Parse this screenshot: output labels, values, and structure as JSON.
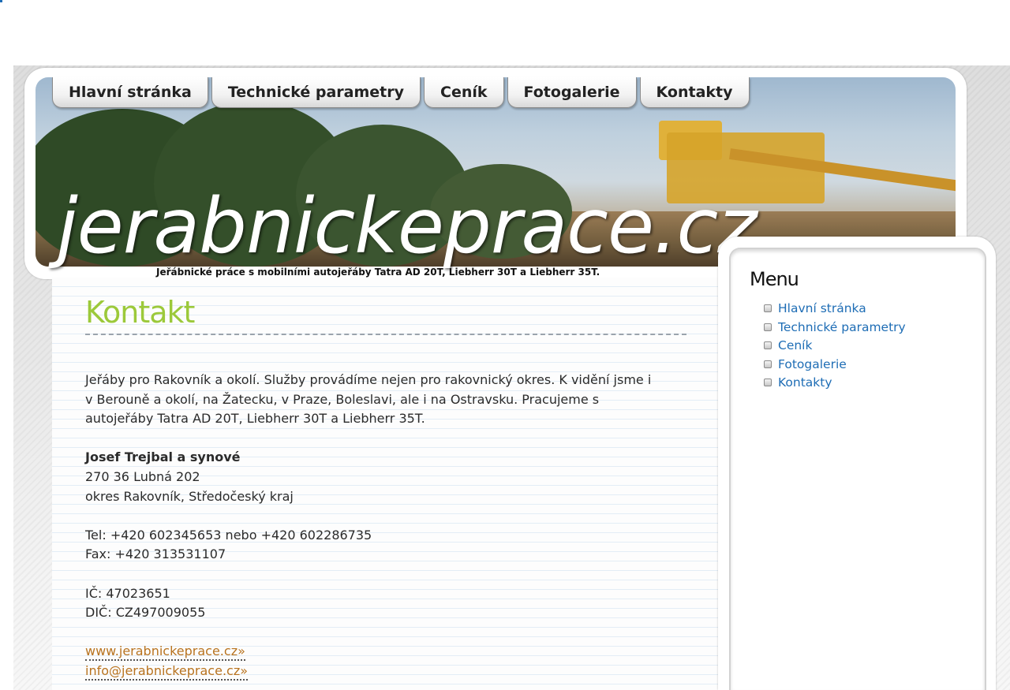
{
  "nav": {
    "tabs": [
      {
        "label": "Hlavní stránka"
      },
      {
        "label": "Technické parametry"
      },
      {
        "label": "Ceník"
      },
      {
        "label": "Fotogalerie"
      },
      {
        "label": "Kontakty"
      }
    ]
  },
  "header": {
    "logo_text": "jerabnickeprace.cz",
    "tagline": "Jeřábnické práce s mobilními autojeřáby Tatra AD 20T, Liebherr 30T a Liebherr 35T."
  },
  "main": {
    "title": "Kontakt",
    "intro_lines": [
      "Jeřáby pro Rakovník a okolí. Služby provádíme nejen pro rakovnický okres. K vidění jsme i",
      "v Berouně a okolí, na Žatecku, v Praze, Boleslavi, ale i na Ostravsku. Pracujeme s",
      "autojeřáby Tatra AD 20T, Liebherr 30T a Liebherr 35T."
    ],
    "company": "Josef Trejbal a synové",
    "address_line1": "270 36 Lubná 202",
    "address_line2": "okres Rakovník, Středočeský kraj",
    "tel": "Tel: +420 602345653 nebo +420 602286735",
    "fax": "Fax: +420 313531107",
    "ic": "IČ: 47023651",
    "dic": "DIČ: CZ497009055",
    "web_link": "www.jerabnickeprace.cz»",
    "email_link": "info@jerabnickeprace.cz»"
  },
  "sidebar": {
    "heading": "Menu",
    "items": [
      {
        "label": "Hlavní stránka"
      },
      {
        "label": "Technické parametry"
      },
      {
        "label": "Ceník"
      },
      {
        "label": "Fotogalerie"
      },
      {
        "label": "Kontakty"
      }
    ]
  },
  "colors": {
    "title_green": "#9cc93a",
    "link_blue": "#1e6db5",
    "link_orange": "#b8731f"
  }
}
